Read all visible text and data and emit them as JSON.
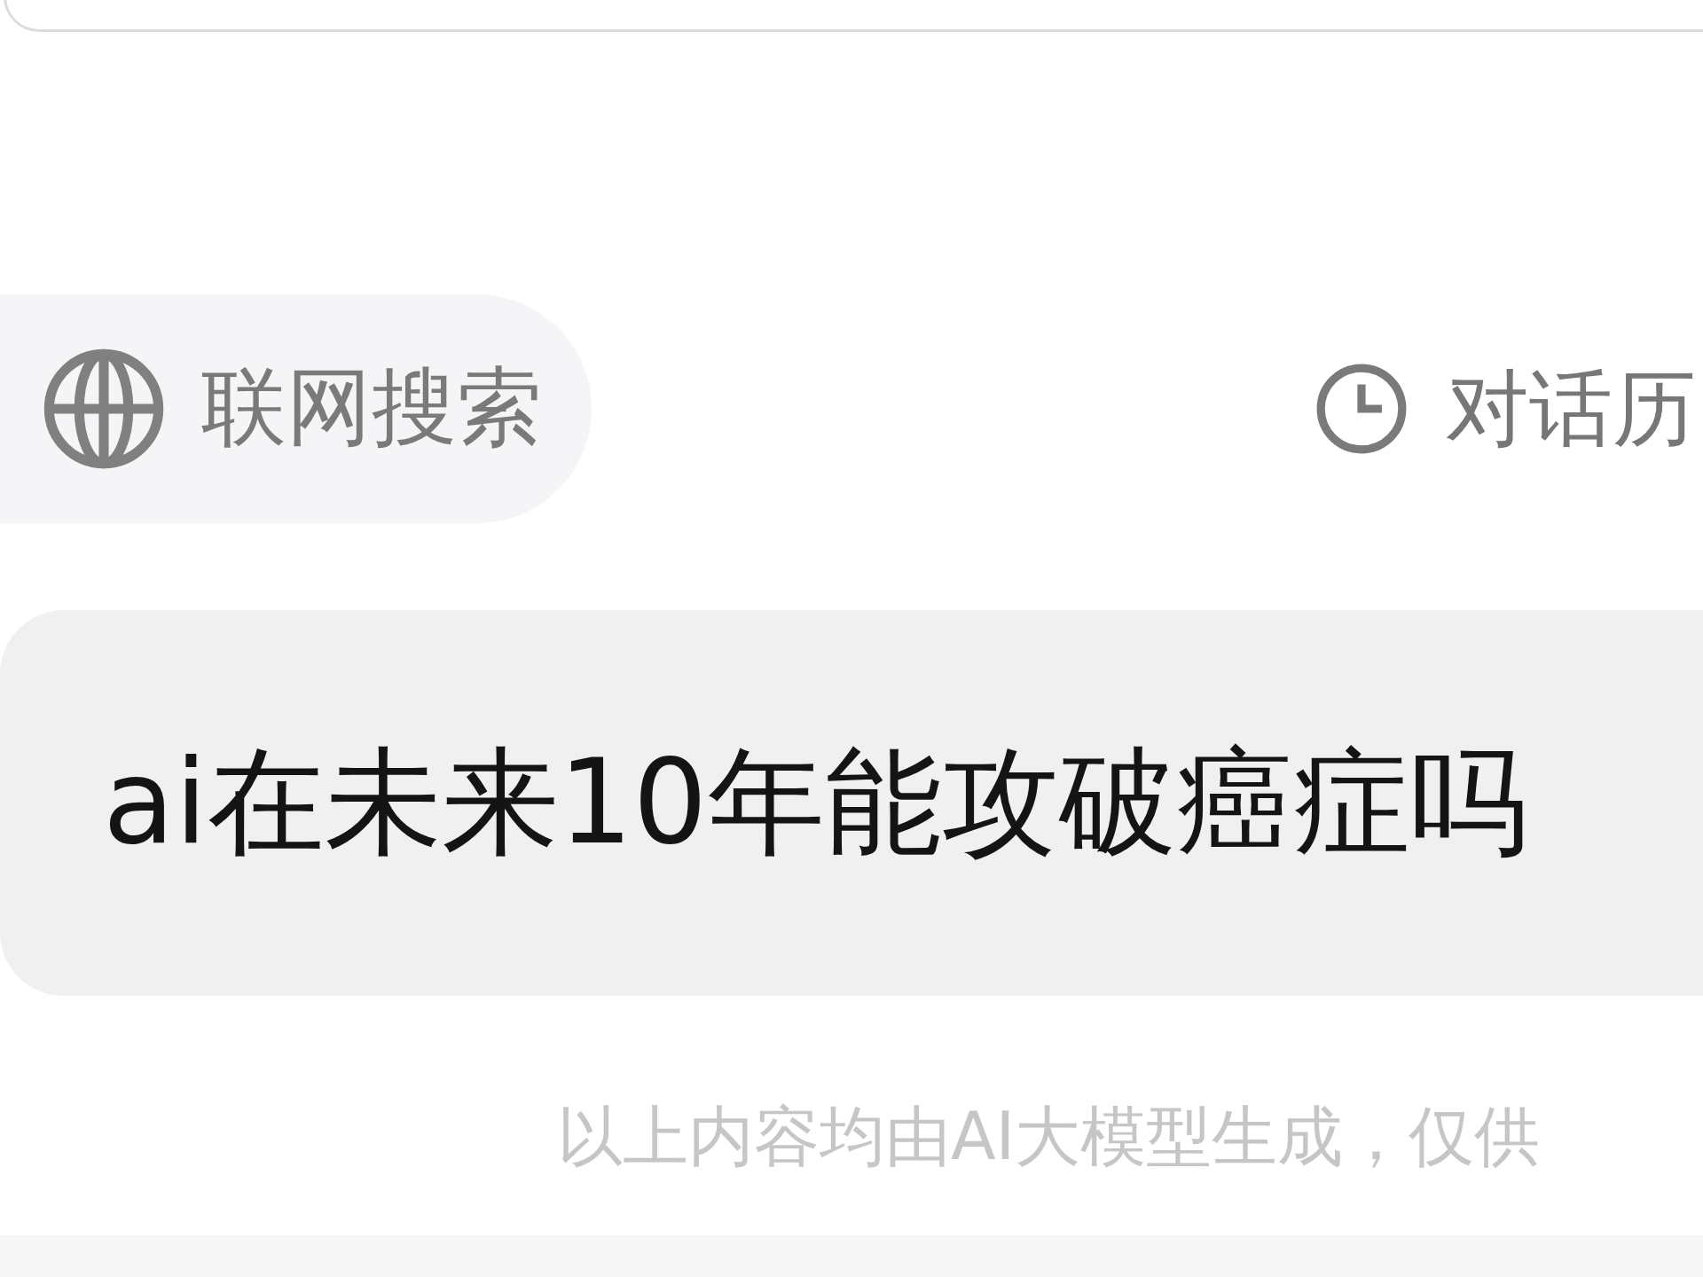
{
  "toolbar": {
    "web_search": {
      "label": "联网搜索"
    },
    "history": {
      "label": "对话历"
    }
  },
  "message": {
    "text": "ai在未来10年能攻破癌症吗"
  },
  "disclaimer": "以上内容均由AI大模型生成，仅供"
}
